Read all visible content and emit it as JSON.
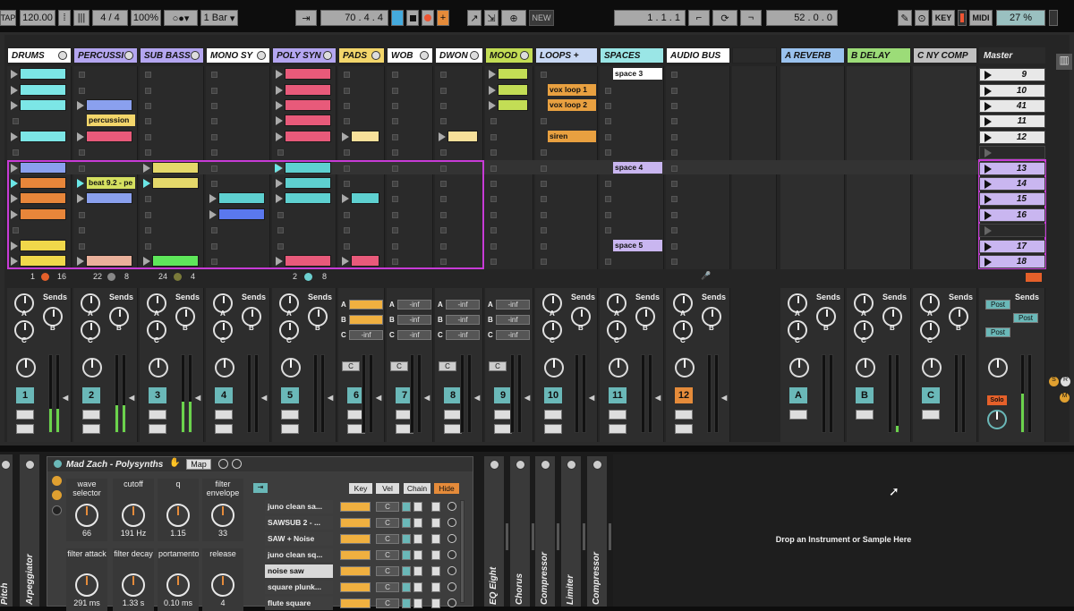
{
  "transport": {
    "tap": "TAP",
    "tempo": "120.00",
    "sig": "4 / 4",
    "zoom": "100%",
    "quant": "1 Bar",
    "position": "70 . 4 . 4",
    "new_btn": "NEW",
    "loop_start": "1 . 1 . 1",
    "loop_len": "52 . 0 . 0",
    "key": "KEY",
    "midi": "MIDI",
    "cpu": "27 %"
  },
  "tracks": [
    {
      "name": "DRUMS",
      "color": "#ffffff"
    },
    {
      "name": "PERCUSSI",
      "color": "#b4a6f0"
    },
    {
      "name": "SUB BASS",
      "color": "#b4a6f0"
    },
    {
      "name": "MONO SY",
      "color": "#ffffff"
    },
    {
      "name": "POLY SYN",
      "color": "#b4a6f0"
    },
    {
      "name": "PADS",
      "color": "#f3d66b"
    },
    {
      "name": "WOB",
      "color": "#ffffff"
    },
    {
      "name": "DWON",
      "color": "#ffffff"
    },
    {
      "name": "MOOD",
      "color": "#c3dd55"
    },
    {
      "name": "LOOPS +",
      "color": "#c8d8f4"
    },
    {
      "name": "SPACES",
      "color": "#9ae6e6"
    },
    {
      "name": "AUDIO BUS",
      "color": "#ffffff"
    }
  ],
  "returns": [
    {
      "name": "A REVERB",
      "color": "#9ac2ee"
    },
    {
      "name": "B DELAY",
      "color": "#9cdc78"
    },
    {
      "name": "C NY COMP",
      "color": "#c0c0c0"
    }
  ],
  "master": {
    "label": "Master",
    "post": "Post"
  },
  "clip_labels": {
    "percussion": "percussion",
    "beat": "beat 9.2 - pe",
    "vox1": "vox loop 1",
    "vox2": "vox loop 2",
    "siren": "siren",
    "space3": "space 3",
    "space4": "space 4",
    "space5": "space 5"
  },
  "scenes": [
    "9",
    "10",
    "41",
    "11",
    "12",
    "",
    "13",
    "14",
    "15",
    "16",
    "",
    "17",
    "18"
  ],
  "track_info": {
    "drums_a": "1",
    "drums_b": "16",
    "perc_a": "22",
    "perc_b": "8",
    "sub_a": "24",
    "sub_b": "4",
    "poly_a": "2",
    "poly_b": "8"
  },
  "sends": {
    "label": "Sends",
    "a": "A",
    "b": "B",
    "c": "C",
    "inf": "-inf"
  },
  "track_numbers": [
    "1",
    "2",
    "3",
    "4",
    "5",
    "6",
    "7",
    "8",
    "9",
    "10",
    "11",
    "12"
  ],
  "return_letters": [
    "A",
    "B",
    "C"
  ],
  "pan_c": "C",
  "solo": "Solo",
  "device": {
    "title": "Mad Zach - Polysynths",
    "map": "Map",
    "params": [
      {
        "label": "wave selector",
        "value": "66"
      },
      {
        "label": "cutoff",
        "value": "191 Hz"
      },
      {
        "label": "q",
        "value": "1.15"
      },
      {
        "label": "filter envelope",
        "value": "33"
      },
      {
        "label": "filter attack",
        "value": "291 ms"
      },
      {
        "label": "filter decay",
        "value": "1.33 s"
      },
      {
        "label": "portamento",
        "value": "0.10 ms"
      },
      {
        "label": "release",
        "value": "4"
      }
    ],
    "key_btn": "Key",
    "vel_btn": "Vel",
    "chain_btn": "Chain",
    "hide_btn": "Hide",
    "chains": [
      "juno clean sa...",
      "SAWSUB 2 - ...",
      "SAW + Noise",
      "juno clean sq...",
      "noise saw",
      "square plunk...",
      "flute square"
    ],
    "pan_c": "C"
  },
  "side_devices": [
    "Pitch",
    "Arpeggiator",
    "EQ Eight",
    "Chorus",
    "Compressor",
    "Limiter",
    "Compressor"
  ],
  "drop_text": "Drop an Instrument or Sample Here"
}
